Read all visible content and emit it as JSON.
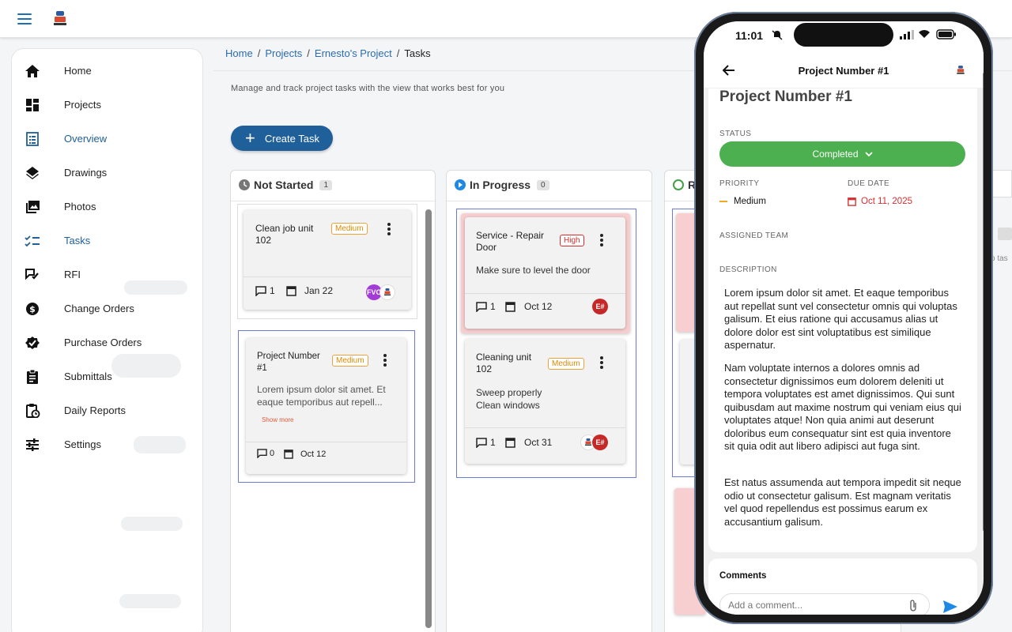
{
  "topbar": {
    "menu_icon": "hamburger-icon",
    "logo_icon": "company-logo"
  },
  "sidebar": {
    "items": [
      {
        "label": "Home",
        "icon": "home-icon"
      },
      {
        "label": "Projects",
        "icon": "dashboard-icon"
      },
      {
        "label": "Overview",
        "icon": "list-alt-icon",
        "active": true
      },
      {
        "label": "Drawings",
        "icon": "layers-icon"
      },
      {
        "label": "Photos",
        "icon": "photo-library-icon"
      },
      {
        "label": "Tasks",
        "icon": "checklist-icon",
        "active": true
      },
      {
        "label": "RFI",
        "icon": "rfi-icon"
      },
      {
        "label": "Change Orders",
        "icon": "dollar-icon"
      },
      {
        "label": "Purchase Orders",
        "icon": "verified-icon"
      },
      {
        "label": "Submittals",
        "icon": "assignment-icon"
      },
      {
        "label": "Daily Reports",
        "icon": "clipboard-clock-icon"
      },
      {
        "label": "Settings",
        "icon": "tune-icon"
      }
    ]
  },
  "breadcrumb": {
    "home": "Home",
    "projects": "Projects",
    "project": "Ernesto's Project",
    "current": "Tasks",
    "sep": "/"
  },
  "page": {
    "subtitle": "Manage and track project tasks with the view that works best for you",
    "create_label": "Create Task"
  },
  "columns": {
    "not_started": {
      "title": "Not Started",
      "count": "1",
      "cards": [
        {
          "title": "Clean job unit 102",
          "priority": "Medium",
          "comments": "1",
          "due": "Jan 22",
          "avatar1": "FVC"
        },
        {
          "title": "Project Number #1",
          "priority": "Medium",
          "desc": "Lorem ipsum dolor sit amet. Et eaque temporibus aut repell...",
          "show_more": "Show more",
          "comments": "0",
          "due": "Oct 12"
        }
      ]
    },
    "in_progress": {
      "title": "In Progress",
      "count": "0",
      "cards": [
        {
          "title": "Service - Repair Door",
          "priority": "High",
          "desc": "Make sure to level the door",
          "comments": "1",
          "due": "Oct 12",
          "avatar1": "E#"
        },
        {
          "title": "Cleaning unit 102",
          "priority": "Medium",
          "desc1": "Sweep properly",
          "desc2": "Clean windows",
          "comments": "1",
          "due": "Oct 31",
          "avatar1": "E#"
        }
      ]
    },
    "review": {
      "title": "R"
    }
  },
  "colors": {
    "primary": "#1f5f9a",
    "success": "#43a047",
    "danger": "#d32f2f",
    "warning": "#e08a00"
  },
  "phone": {
    "status": {
      "time": "11:01"
    },
    "appbar": {
      "title": "Project Number #1"
    },
    "detail": {
      "title": "Project Number #1",
      "status_label": "STATUS",
      "status_value": "Completed",
      "priority_label": "PRIORITY",
      "priority_value": "Medium",
      "due_label": "DUE DATE",
      "due_value": "Oct 11, 2025",
      "team_label": "ASSIGNED TEAM",
      "desc_label": "DESCRIPTION",
      "p1": "Lorem ipsum dolor sit amet. Et eaque temporibus aut repellat sunt vel consectetur omnis qui voluptas galisum. Et eius ratione qui accusamus alias ut dolore dolor est sint voluptatibus est similique aspernatur.",
      "p2": "Nam voluptate internos a dolores omnis ad consectetur dignissimos eum dolorem deleniti ut tempora voluptates est amet dignissimos. Qui sunt quibusdam aut maxime nostrum qui veniam eius qui voluptates atque! Non quia animi aut deserunt doloribus eum consequatur sint est quia inventore sit quia odit aut libero adipisci aut fuga sint.",
      "p3": "Est natus assumenda aut tempora impedit sit neque odio ut consectetur galisum. Est magnam veritatis vel quod repellendus est possimus earum ex accusantium galisum."
    },
    "comments": {
      "title": "Comments",
      "placeholder": "Add a comment..."
    }
  },
  "behind": {
    "peek_text": "o tas"
  }
}
